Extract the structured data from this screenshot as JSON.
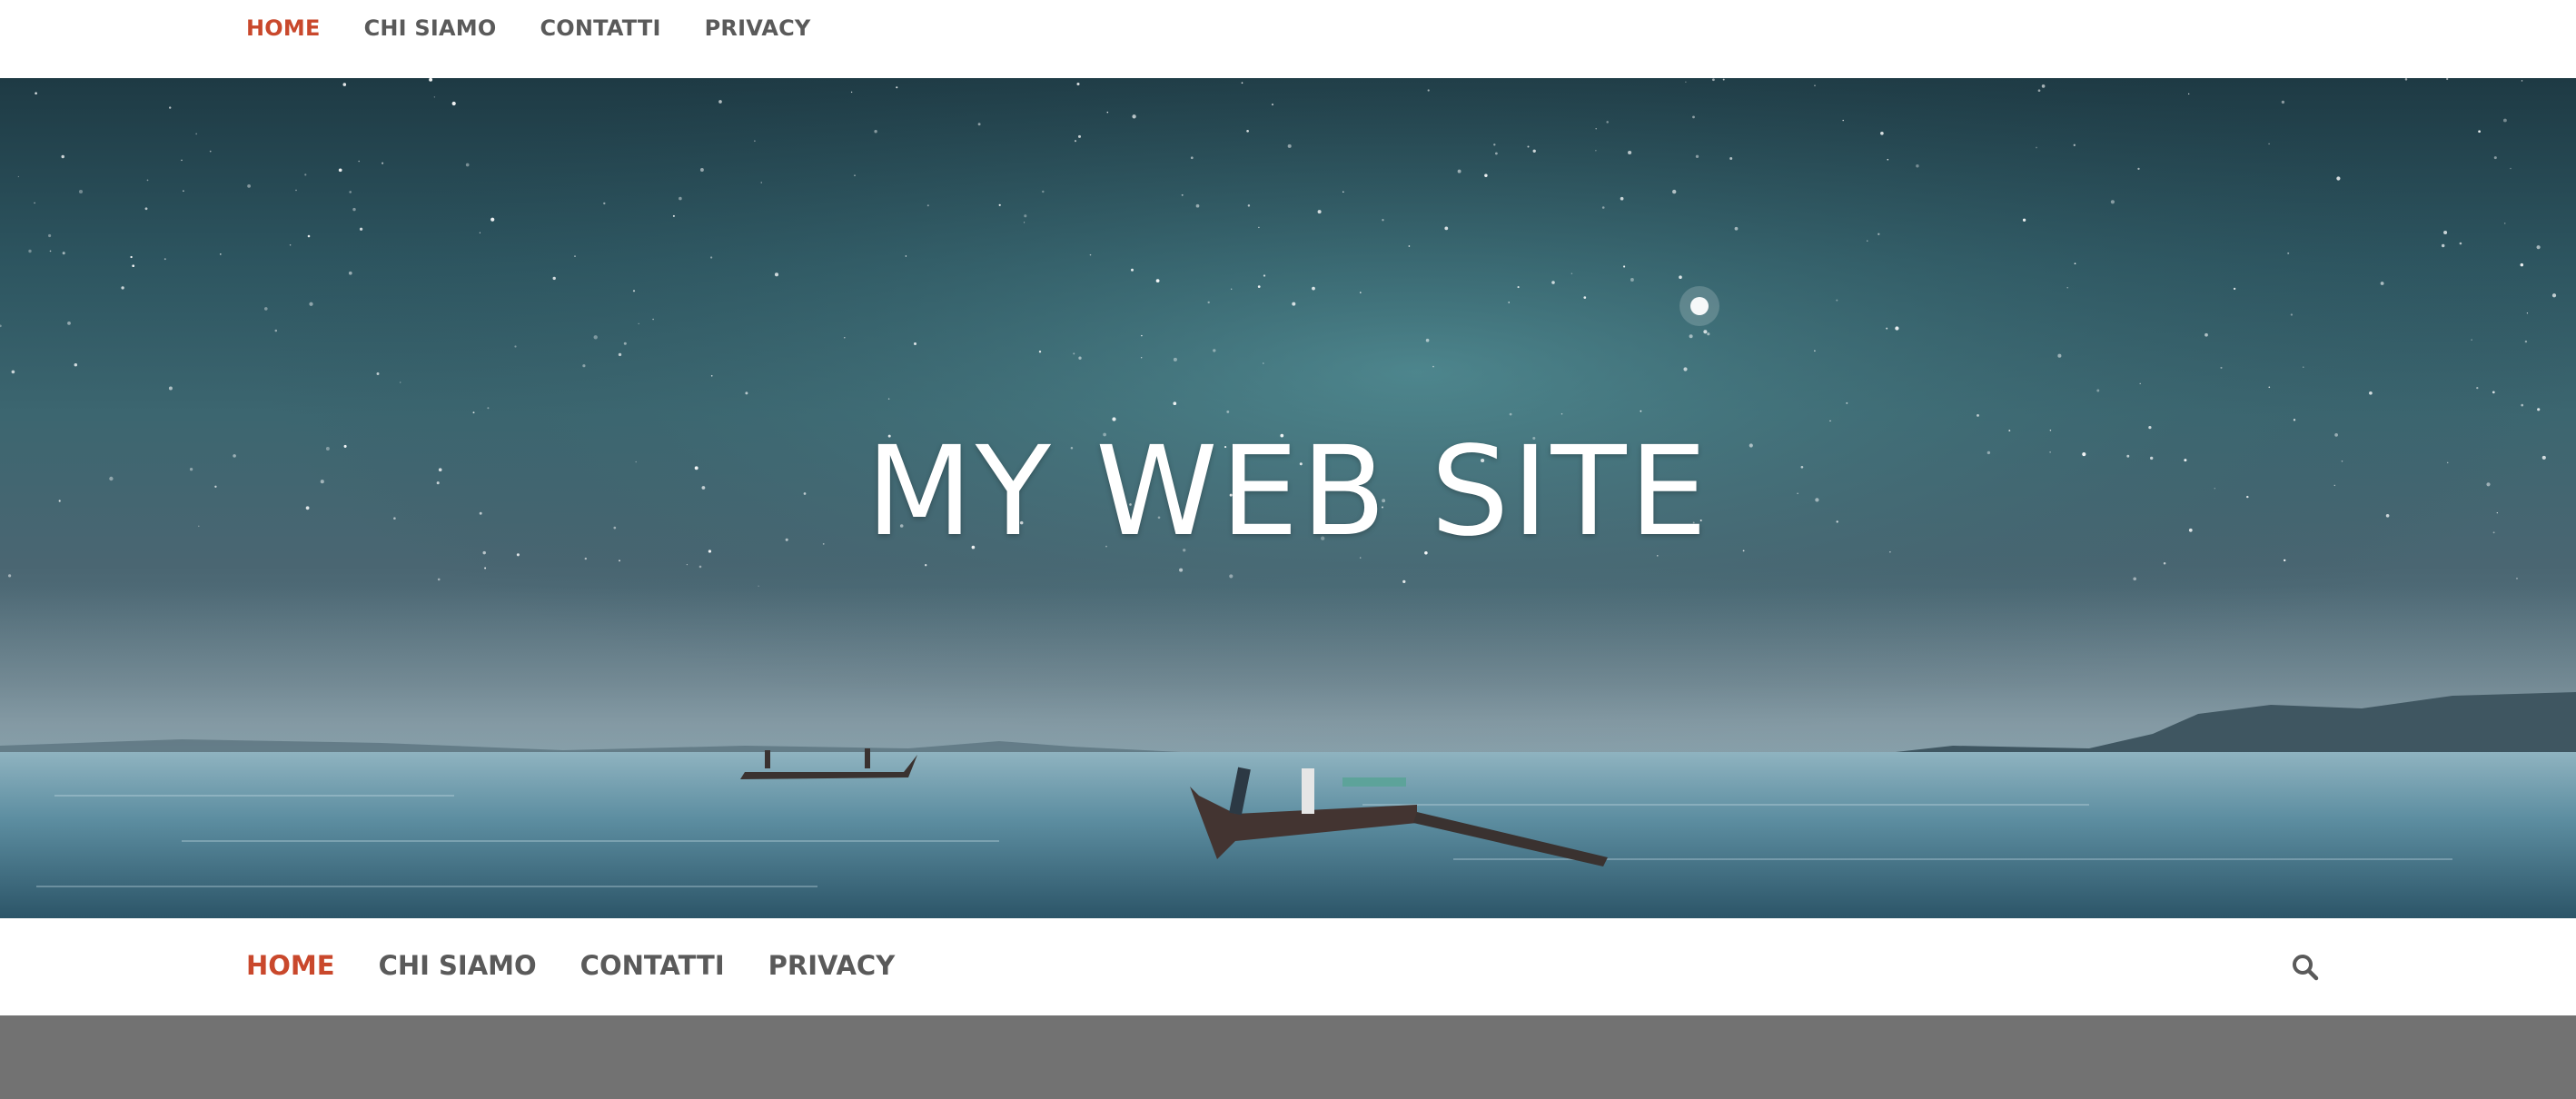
{
  "top_nav": {
    "items": [
      {
        "label": "HOME",
        "active": true
      },
      {
        "label": "CHI SIAMO",
        "active": false
      },
      {
        "label": "CONTATTI",
        "active": false
      },
      {
        "label": "PRIVACY",
        "active": false
      }
    ]
  },
  "hero": {
    "title": "MY WEB SITE"
  },
  "main_nav": {
    "items": [
      {
        "label": "HOME",
        "active": true
      },
      {
        "label": "CHI SIAMO",
        "active": false
      },
      {
        "label": "CONTATTI",
        "active": false
      },
      {
        "label": "PRIVACY",
        "active": false
      }
    ],
    "search_icon": "search-icon"
  },
  "colors": {
    "accent": "#c9482c",
    "nav_text": "#5a5a5a",
    "footer_band": "#727272"
  }
}
